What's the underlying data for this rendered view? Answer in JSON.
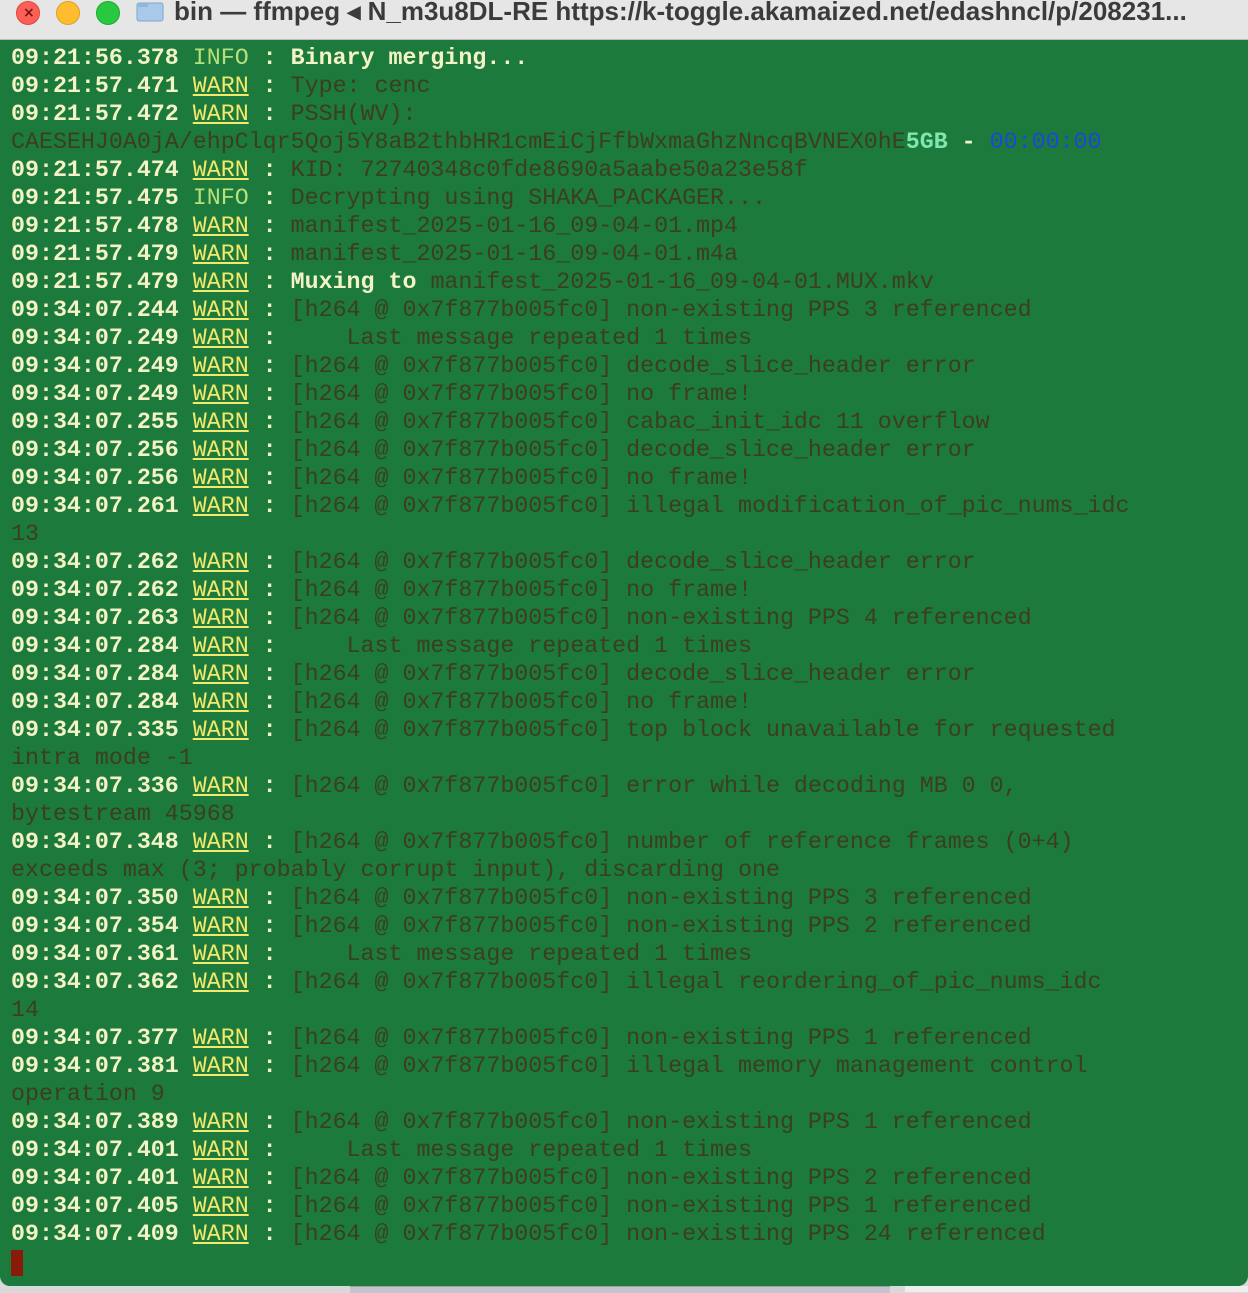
{
  "window": {
    "title": "bin — ffmpeg ◂ N_m3u8DL-RE https://k-toggle.akamaized.net/edashncl/p/208231...",
    "background": "#1b7a3c"
  },
  "icons": {
    "close": "close-icon",
    "minimize": "minimize-icon",
    "maximize": "maximize-icon",
    "folder": "folder-icon"
  },
  "colors": {
    "timestamp": "#f3f3c5",
    "info": "#b8e07a",
    "warn": "#f5e86a",
    "dim_message": "#3d3d22",
    "progress_size": "#7fe6ae",
    "progress_time": "#1c47d8"
  },
  "log": [
    {
      "ts": "09:21:56.378",
      "lvl": "INFO",
      "msg": "Binary merging...",
      "style": "bright"
    },
    {
      "ts": "09:21:57.471",
      "lvl": "WARN",
      "msg": "Type: cenc",
      "style": "dim"
    },
    {
      "ts": "09:21:57.472",
      "lvl": "WARN",
      "msg": "PSSH(WV):",
      "style": "dim"
    },
    {
      "type": "progress",
      "text": "CAESEHJ0A0jA/ehpClqr5Qoj5Y8aB2thbHR1cmEiCjFfbWxmaGhzNncqBVNEX0hE",
      "size": "5GB",
      "dash": " - ",
      "time": "00:00:00"
    },
    {
      "ts": "09:21:57.474",
      "lvl": "WARN",
      "msg": "KID: 72740348c0fde8690a5aabe50a23e58f",
      "style": "dim"
    },
    {
      "ts": "09:21:57.475",
      "lvl": "INFO",
      "msg": "Decrypting using SHAKA_PACKAGER...",
      "style": "dim"
    },
    {
      "ts": "09:21:57.478",
      "lvl": "WARN",
      "msg": "manifest_2025-01-16_09-04-01.mp4",
      "style": "dim"
    },
    {
      "ts": "09:21:57.479",
      "lvl": "WARN",
      "msg": "manifest_2025-01-16_09-04-01.m4a",
      "style": "dim"
    },
    {
      "ts": "09:21:57.479",
      "lvl": "WARN",
      "msg_bright": "Muxing to ",
      "msg": "manifest_2025-01-16_09-04-01.MUX.mkv",
      "style": "mixed"
    },
    {
      "ts": "09:34:07.244",
      "lvl": "WARN",
      "msg": "[h264 @ 0x7f877b005fc0] non-existing PPS 3 referenced",
      "style": "dim"
    },
    {
      "ts": "09:34:07.249",
      "lvl": "WARN",
      "msg": "    Last message repeated 1 times",
      "style": "dim"
    },
    {
      "ts": "09:34:07.249",
      "lvl": "WARN",
      "msg": "[h264 @ 0x7f877b005fc0] decode_slice_header error",
      "style": "dim"
    },
    {
      "ts": "09:34:07.249",
      "lvl": "WARN",
      "msg": "[h264 @ 0x7f877b005fc0] no frame!",
      "style": "dim"
    },
    {
      "ts": "09:34:07.255",
      "lvl": "WARN",
      "msg": "[h264 @ 0x7f877b005fc0] cabac_init_idc 11 overflow",
      "style": "dim"
    },
    {
      "ts": "09:34:07.256",
      "lvl": "WARN",
      "msg": "[h264 @ 0x7f877b005fc0] decode_slice_header error",
      "style": "dim"
    },
    {
      "ts": "09:34:07.256",
      "lvl": "WARN",
      "msg": "[h264 @ 0x7f877b005fc0] no frame!",
      "style": "dim"
    },
    {
      "ts": "09:34:07.261",
      "lvl": "WARN",
      "msg": "[h264 @ 0x7f877b005fc0] illegal modification_of_pic_nums_idc",
      "style": "dim"
    },
    {
      "type": "cont",
      "text": "13"
    },
    {
      "ts": "09:34:07.262",
      "lvl": "WARN",
      "msg": "[h264 @ 0x7f877b005fc0] decode_slice_header error",
      "style": "dim"
    },
    {
      "ts": "09:34:07.262",
      "lvl": "WARN",
      "msg": "[h264 @ 0x7f877b005fc0] no frame!",
      "style": "dim"
    },
    {
      "ts": "09:34:07.263",
      "lvl": "WARN",
      "msg": "[h264 @ 0x7f877b005fc0] non-existing PPS 4 referenced",
      "style": "dim"
    },
    {
      "ts": "09:34:07.284",
      "lvl": "WARN",
      "msg": "    Last message repeated 1 times",
      "style": "dim"
    },
    {
      "ts": "09:34:07.284",
      "lvl": "WARN",
      "msg": "[h264 @ 0x7f877b005fc0] decode_slice_header error",
      "style": "dim"
    },
    {
      "ts": "09:34:07.284",
      "lvl": "WARN",
      "msg": "[h264 @ 0x7f877b005fc0] no frame!",
      "style": "dim"
    },
    {
      "ts": "09:34:07.335",
      "lvl": "WARN",
      "msg": "[h264 @ 0x7f877b005fc0] top block unavailable for requested",
      "style": "dim"
    },
    {
      "type": "cont",
      "text": "intra mode -1"
    },
    {
      "ts": "09:34:07.336",
      "lvl": "WARN",
      "msg": "[h264 @ 0x7f877b005fc0] error while decoding MB 0 0,",
      "style": "dim"
    },
    {
      "type": "cont",
      "text": "bytestream 45968"
    },
    {
      "ts": "09:34:07.348",
      "lvl": "WARN",
      "msg": "[h264 @ 0x7f877b005fc0] number of reference frames (0+4)",
      "style": "dim"
    },
    {
      "type": "cont",
      "text": "exceeds max (3; probably corrupt input), discarding one"
    },
    {
      "ts": "09:34:07.350",
      "lvl": "WARN",
      "msg": "[h264 @ 0x7f877b005fc0] non-existing PPS 3 referenced",
      "style": "dim"
    },
    {
      "ts": "09:34:07.354",
      "lvl": "WARN",
      "msg": "[h264 @ 0x7f877b005fc0] non-existing PPS 2 referenced",
      "style": "dim"
    },
    {
      "ts": "09:34:07.361",
      "lvl": "WARN",
      "msg": "    Last message repeated 1 times",
      "style": "dim"
    },
    {
      "ts": "09:34:07.362",
      "lvl": "WARN",
      "msg": "[h264 @ 0x7f877b005fc0] illegal reordering_of_pic_nums_idc",
      "style": "dim"
    },
    {
      "type": "cont",
      "text": "14"
    },
    {
      "ts": "09:34:07.377",
      "lvl": "WARN",
      "msg": "[h264 @ 0x7f877b005fc0] non-existing PPS 1 referenced",
      "style": "dim"
    },
    {
      "ts": "09:34:07.381",
      "lvl": "WARN",
      "msg": "[h264 @ 0x7f877b005fc0] illegal memory management control",
      "style": "dim"
    },
    {
      "type": "cont",
      "text": "operation 9"
    },
    {
      "ts": "09:34:07.389",
      "lvl": "WARN",
      "msg": "[h264 @ 0x7f877b005fc0] non-existing PPS 1 referenced",
      "style": "dim"
    },
    {
      "ts": "09:34:07.401",
      "lvl": "WARN",
      "msg": "    Last message repeated 1 times",
      "style": "dim"
    },
    {
      "ts": "09:34:07.401",
      "lvl": "WARN",
      "msg": "[h264 @ 0x7f877b005fc0] non-existing PPS 2 referenced",
      "style": "dim"
    },
    {
      "ts": "09:34:07.405",
      "lvl": "WARN",
      "msg": "[h264 @ 0x7f877b005fc0] non-existing PPS 1 referenced",
      "style": "dim"
    },
    {
      "ts": "09:34:07.409",
      "lvl": "WARN",
      "msg": "[h264 @ 0x7f877b005fc0] non-existing PPS 24 referenced",
      "style": "dim"
    }
  ]
}
